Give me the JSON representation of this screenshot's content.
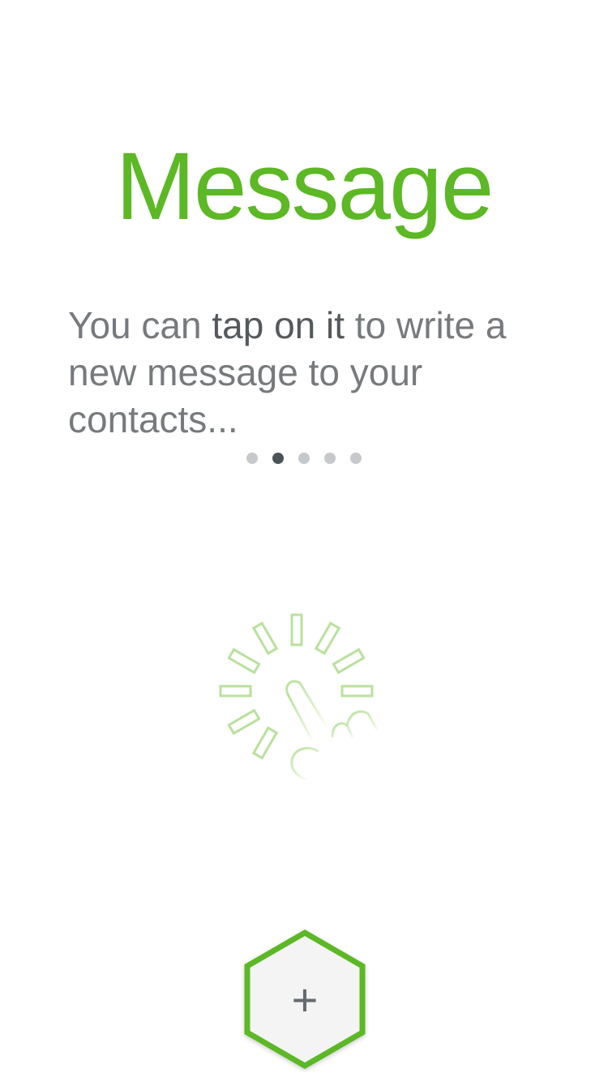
{
  "onboarding": {
    "title": "Message",
    "description_prefix": "You can ",
    "description_emphasis": "tap on it",
    "description_suffix": " to write a new message to your contacts...",
    "page_count": 5,
    "current_page_index": 1
  },
  "fab": {
    "label": "+",
    "icon": "plus-icon"
  },
  "illustration": {
    "icon": "tap-gesture-icon"
  },
  "colors": {
    "accent": "#5cb825",
    "text": "#777a7d",
    "text_emphasis": "#55595c",
    "dot_inactive": "#c6c9cc",
    "dot_active": "#4c5358",
    "fab_fill": "#f4f4f4",
    "illustration": "#b9e19d"
  }
}
